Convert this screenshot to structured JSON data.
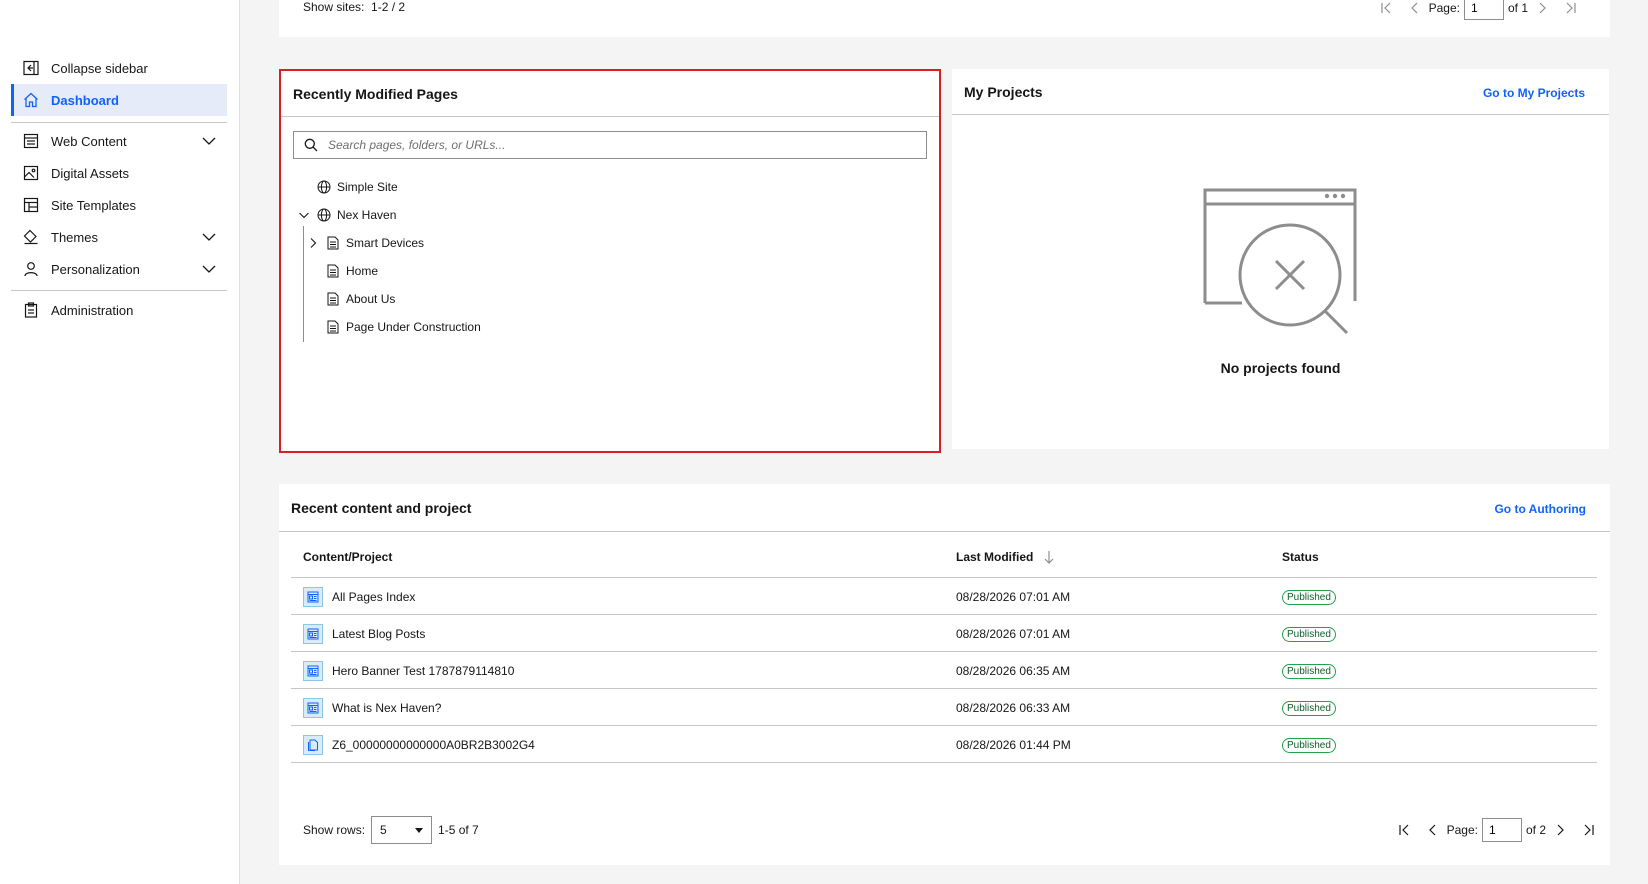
{
  "sidebar": {
    "items": [
      {
        "label": "Collapse sidebar",
        "icon": "collapse-sidebar-icon"
      },
      {
        "label": "Dashboard",
        "icon": "home-icon",
        "active": true
      },
      {
        "label": "Web Content",
        "icon": "web-content-icon",
        "expandable": true
      },
      {
        "label": "Digital Assets",
        "icon": "image-icon"
      },
      {
        "label": "Site Templates",
        "icon": "template-icon"
      },
      {
        "label": "Themes",
        "icon": "paint-bucket-icon",
        "expandable": true
      },
      {
        "label": "Personalization",
        "icon": "user-icon",
        "expandable": true
      },
      {
        "label": "Administration",
        "icon": "clipboard-icon"
      }
    ]
  },
  "sites_card": {
    "show_sites_label": "Show sites:",
    "range": "1-2 / 2",
    "page_label": "Page:",
    "page_value": "1",
    "of_label": "of 1"
  },
  "recent_pages": {
    "title": "Recently Modified Pages",
    "search_placeholder": "Search pages, folders, or URLs...",
    "tree": [
      {
        "label": "Simple Site",
        "icon": "globe-icon"
      },
      {
        "label": "Nex Haven",
        "icon": "globe-icon",
        "expanded": true
      },
      {
        "label": "Smart Devices",
        "icon": "page-icon",
        "collapsed": true
      },
      {
        "label": "Home",
        "icon": "page-icon"
      },
      {
        "label": "About Us",
        "icon": "page-icon"
      },
      {
        "label": "Page Under Construction",
        "icon": "page-icon"
      }
    ]
  },
  "projects": {
    "title": "My Projects",
    "link": "Go to My Projects",
    "empty_text": "No projects found"
  },
  "recent_content": {
    "title": "Recent content and project",
    "link": "Go to Authoring",
    "columns": [
      "Content/Project",
      "Last Modified",
      "Status"
    ],
    "rows": [
      {
        "name": "All Pages Index",
        "modified": "08/28/2026 07:01 AM",
        "status": "Published",
        "icon": "content-icon"
      },
      {
        "name": "Latest Blog Posts",
        "modified": "08/28/2026 07:01 AM",
        "status": "Published",
        "icon": "content-icon"
      },
      {
        "name": "Hero Banner Test 1787879114810",
        "modified": "08/28/2026 06:35 AM",
        "status": "Published",
        "icon": "content-icon"
      },
      {
        "name": "What is Nex Haven?",
        "modified": "08/28/2026 06:33 AM",
        "status": "Published",
        "icon": "content-icon"
      },
      {
        "name": "Z6_00000000000000A0BR2B3002G4",
        "modified": "08/28/2026 01:44 PM",
        "status": "Published",
        "icon": "copy-icon"
      }
    ],
    "show_rows_label": "Show rows:",
    "rows_value": "5",
    "range": "1-5 of 7",
    "page_label": "Page:",
    "page_value": "1",
    "of_label": "of 2"
  }
}
